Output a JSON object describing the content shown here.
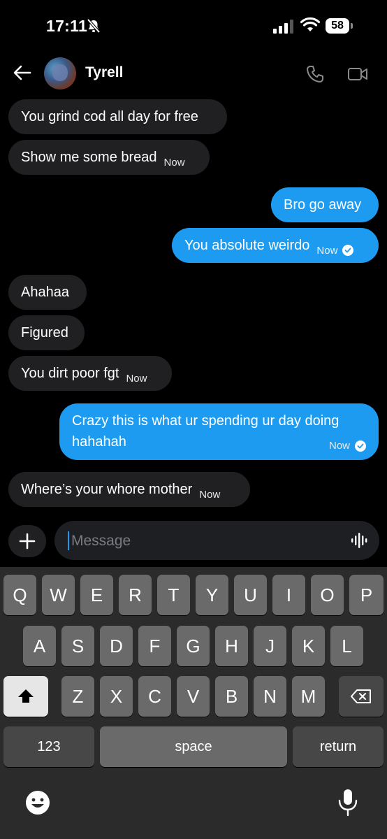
{
  "status_bar": {
    "time": "17:11",
    "battery": "58"
  },
  "header": {
    "contact_name": "Tyrell"
  },
  "messages": [
    {
      "dir": "in",
      "text": "You grind cod all day for free"
    },
    {
      "dir": "in",
      "text": "Show me some bread",
      "time": "Now"
    },
    {
      "dir": "out",
      "text": "Bro go away"
    },
    {
      "dir": "out",
      "text": "You absolute weirdo",
      "time": "Now",
      "read": true
    },
    {
      "dir": "in",
      "text": "Ahahaa"
    },
    {
      "dir": "in",
      "text": "Figured"
    },
    {
      "dir": "in",
      "text": "You dirt poor fgt",
      "time": "Now"
    },
    {
      "dir": "out",
      "text_line1": "Crazy this is what ur spending ur day doing",
      "text_line2": "hahahah",
      "time": "Now",
      "read": true
    },
    {
      "dir": "in",
      "text": "Where’s your whore mother",
      "time": "Now"
    }
  ],
  "compose": {
    "placeholder": "Message"
  },
  "keyboard": {
    "row1": [
      "Q",
      "W",
      "E",
      "R",
      "T",
      "Y",
      "U",
      "I",
      "O",
      "P"
    ],
    "row2": [
      "A",
      "S",
      "D",
      "F",
      "G",
      "H",
      "J",
      "K",
      "L"
    ],
    "row3": [
      "Z",
      "X",
      "C",
      "V",
      "B",
      "N",
      "M"
    ],
    "numbers_label": "123",
    "space_label": "space",
    "return_label": "return"
  },
  "colors": {
    "outgoing_bubble": "#1d9bf0",
    "incoming_bubble": "#202023",
    "background": "#000000"
  }
}
